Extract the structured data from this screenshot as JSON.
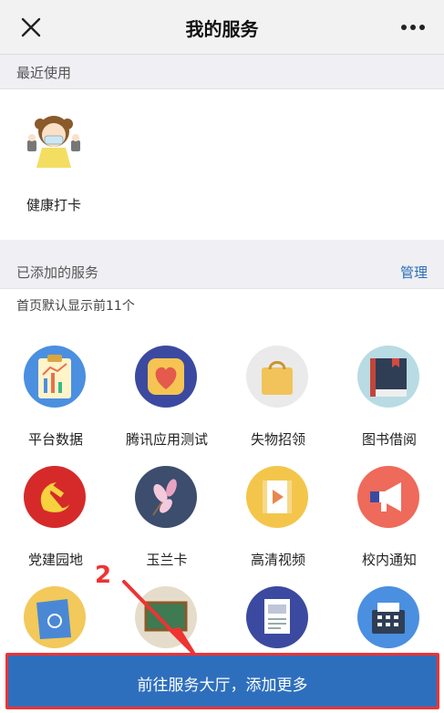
{
  "header": {
    "title": "我的服务",
    "close_icon": "close-icon",
    "more_icon": "more-icon"
  },
  "recent": {
    "label": "最近使用",
    "items": [
      {
        "label": "健康打卡",
        "icon": "health-checkin-icon"
      }
    ]
  },
  "added": {
    "label": "已添加的服务",
    "manage_label": "管理",
    "note": "首页默认显示前11个",
    "items": [
      {
        "label": "平台数据",
        "icon": "clipboard-chart-icon",
        "color": "#4b8fe0"
      },
      {
        "label": "腾讯应用测试",
        "icon": "heart-app-icon",
        "color": "#3b4aa0"
      },
      {
        "label": "失物招领",
        "icon": "shopping-bag-icon",
        "color": "#eaeaea"
      },
      {
        "label": "图书借阅",
        "icon": "book-icon",
        "color": "#b9dbe3"
      },
      {
        "label": "党建园地",
        "icon": "hammer-sickle-icon",
        "color": "#d62a2a"
      },
      {
        "label": "玉兰卡",
        "icon": "magnolia-icon",
        "color": "#3d4d6e"
      },
      {
        "label": "高清视频",
        "icon": "video-icon",
        "color": "#f3c64b"
      },
      {
        "label": "校内通知",
        "icon": "megaphone-icon",
        "color": "#ee6a5a"
      },
      {
        "label": "",
        "icon": "handbook-icon",
        "color": "#f2c95a"
      },
      {
        "label": "",
        "icon": "blackboard-icon",
        "color": "#e6dccb"
      },
      {
        "label": "",
        "icon": "document-icon",
        "color": "#3b4aa0"
      },
      {
        "label": "",
        "icon": "cash-register-icon",
        "color": "#4b8fe0"
      }
    ]
  },
  "annotation": {
    "number": "2"
  },
  "bottom_button": {
    "label": "前往服务大厅，添加更多"
  }
}
